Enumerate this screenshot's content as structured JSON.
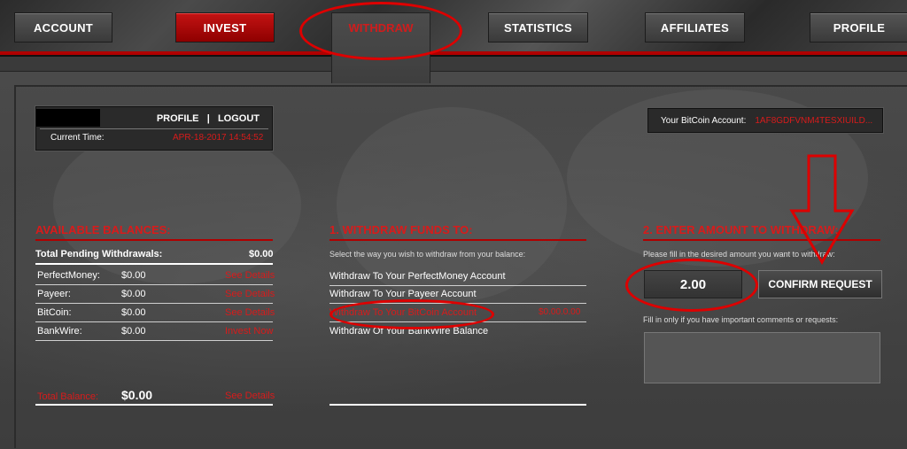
{
  "nav": {
    "account": "ACCOUNT",
    "invest": "INVEST",
    "withdraw": "WITHDRAW",
    "statistics": "STATISTICS",
    "affiliates": "AFFILIATES",
    "profile": "PROFILE"
  },
  "user_box": {
    "profile_link": "PROFILE",
    "separator": "|",
    "logout_link": "LOGOUT",
    "time_label": "Current Time:",
    "time_value": "APR-18-2017 14:54:52"
  },
  "btc_account": {
    "label": "Your BitCoin Account:",
    "value": "1AF8GDFVNM4TESXIUILD..."
  },
  "balances": {
    "title": "AVAILABLE BALANCES:",
    "pending_label": "Total Pending Withdrawals:",
    "pending_value": "$0.00",
    "rows": [
      {
        "name": "PerfectMoney:",
        "amount": "$0.00",
        "action": "See Details"
      },
      {
        "name": "Payeer:",
        "amount": "$0.00",
        "action": "See Details"
      },
      {
        "name": "BitCoin:",
        "amount": "$0.00",
        "action": "See Details"
      },
      {
        "name": "BankWire:",
        "amount": "$0.00",
        "action": "Invest Now"
      }
    ],
    "total_label": "Total Balance:",
    "total_value": "$0.00",
    "total_action": "See Details"
  },
  "withdraw_to": {
    "title": "1. WITHDRAW FUNDS TO:",
    "hint": "Select the way you wish to withdraw from your balance:",
    "options": [
      {
        "label": "Withdraw To Your PerfectMoney Account",
        "extra": ""
      },
      {
        "label": "Withdraw To Your Payeer Account",
        "extra": ""
      },
      {
        "label": "Withdraw To Your BitCoin Account",
        "extra": "$0.00.0.00"
      },
      {
        "label": "Withdraw Of Your BankWire Balance",
        "extra": ""
      }
    ]
  },
  "amount": {
    "title": "2. ENTER AMOUNT TO WITHDRAW:",
    "hint": "Please fill in the desired amount you want to withdraw:",
    "value": "2.00",
    "confirm": "CONFIRM REQUEST",
    "comments_hint": "Fill in only if you have important comments or requests:"
  },
  "colors": {
    "accent_red": "#d81b1b",
    "annotation_red": "#dd0000"
  }
}
